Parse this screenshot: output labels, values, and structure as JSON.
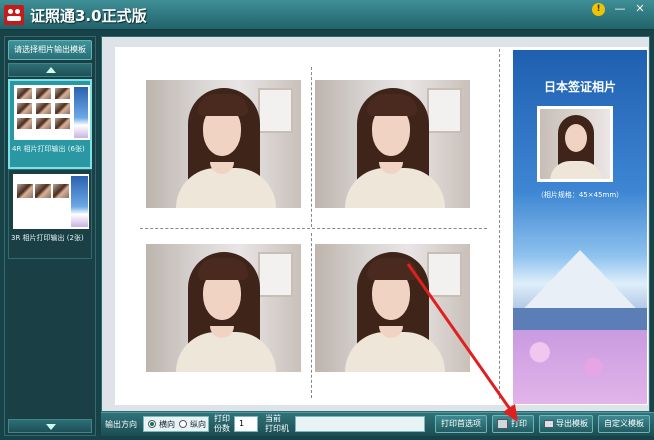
{
  "window": {
    "title": "证照通3.0正式版",
    "info_icon": "!",
    "minimize_icon": "—",
    "close_icon": "✕"
  },
  "sidebar": {
    "header": "请选择相片输出模板",
    "templates": [
      {
        "label": "4R 相片打印输出 (6张)",
        "selected": true
      },
      {
        "label": "3R 相片打印输出 (2张)",
        "selected": false
      }
    ]
  },
  "preview": {
    "visa_card": {
      "title": "日本签证相片",
      "note": "（相片规格：45×45mm）"
    }
  },
  "toolbar": {
    "orientation_label": "输出方向",
    "orientation_options": [
      "横向",
      "纵向"
    ],
    "orientation_selected": "横向",
    "copies_label_1": "打印",
    "copies_label_2": "份数",
    "copies_value": "1",
    "printer_label_1": "当前",
    "printer_label_2": "打印机",
    "printer_value": "",
    "print_options_button": "打印首选项",
    "print_button": "打印",
    "export_button": "导出模板",
    "custom_button": "自定义模板"
  },
  "colors": {
    "title_bar": "#2f7a82",
    "accent": "#2a98a3",
    "annotation_arrow": "#e02020"
  }
}
